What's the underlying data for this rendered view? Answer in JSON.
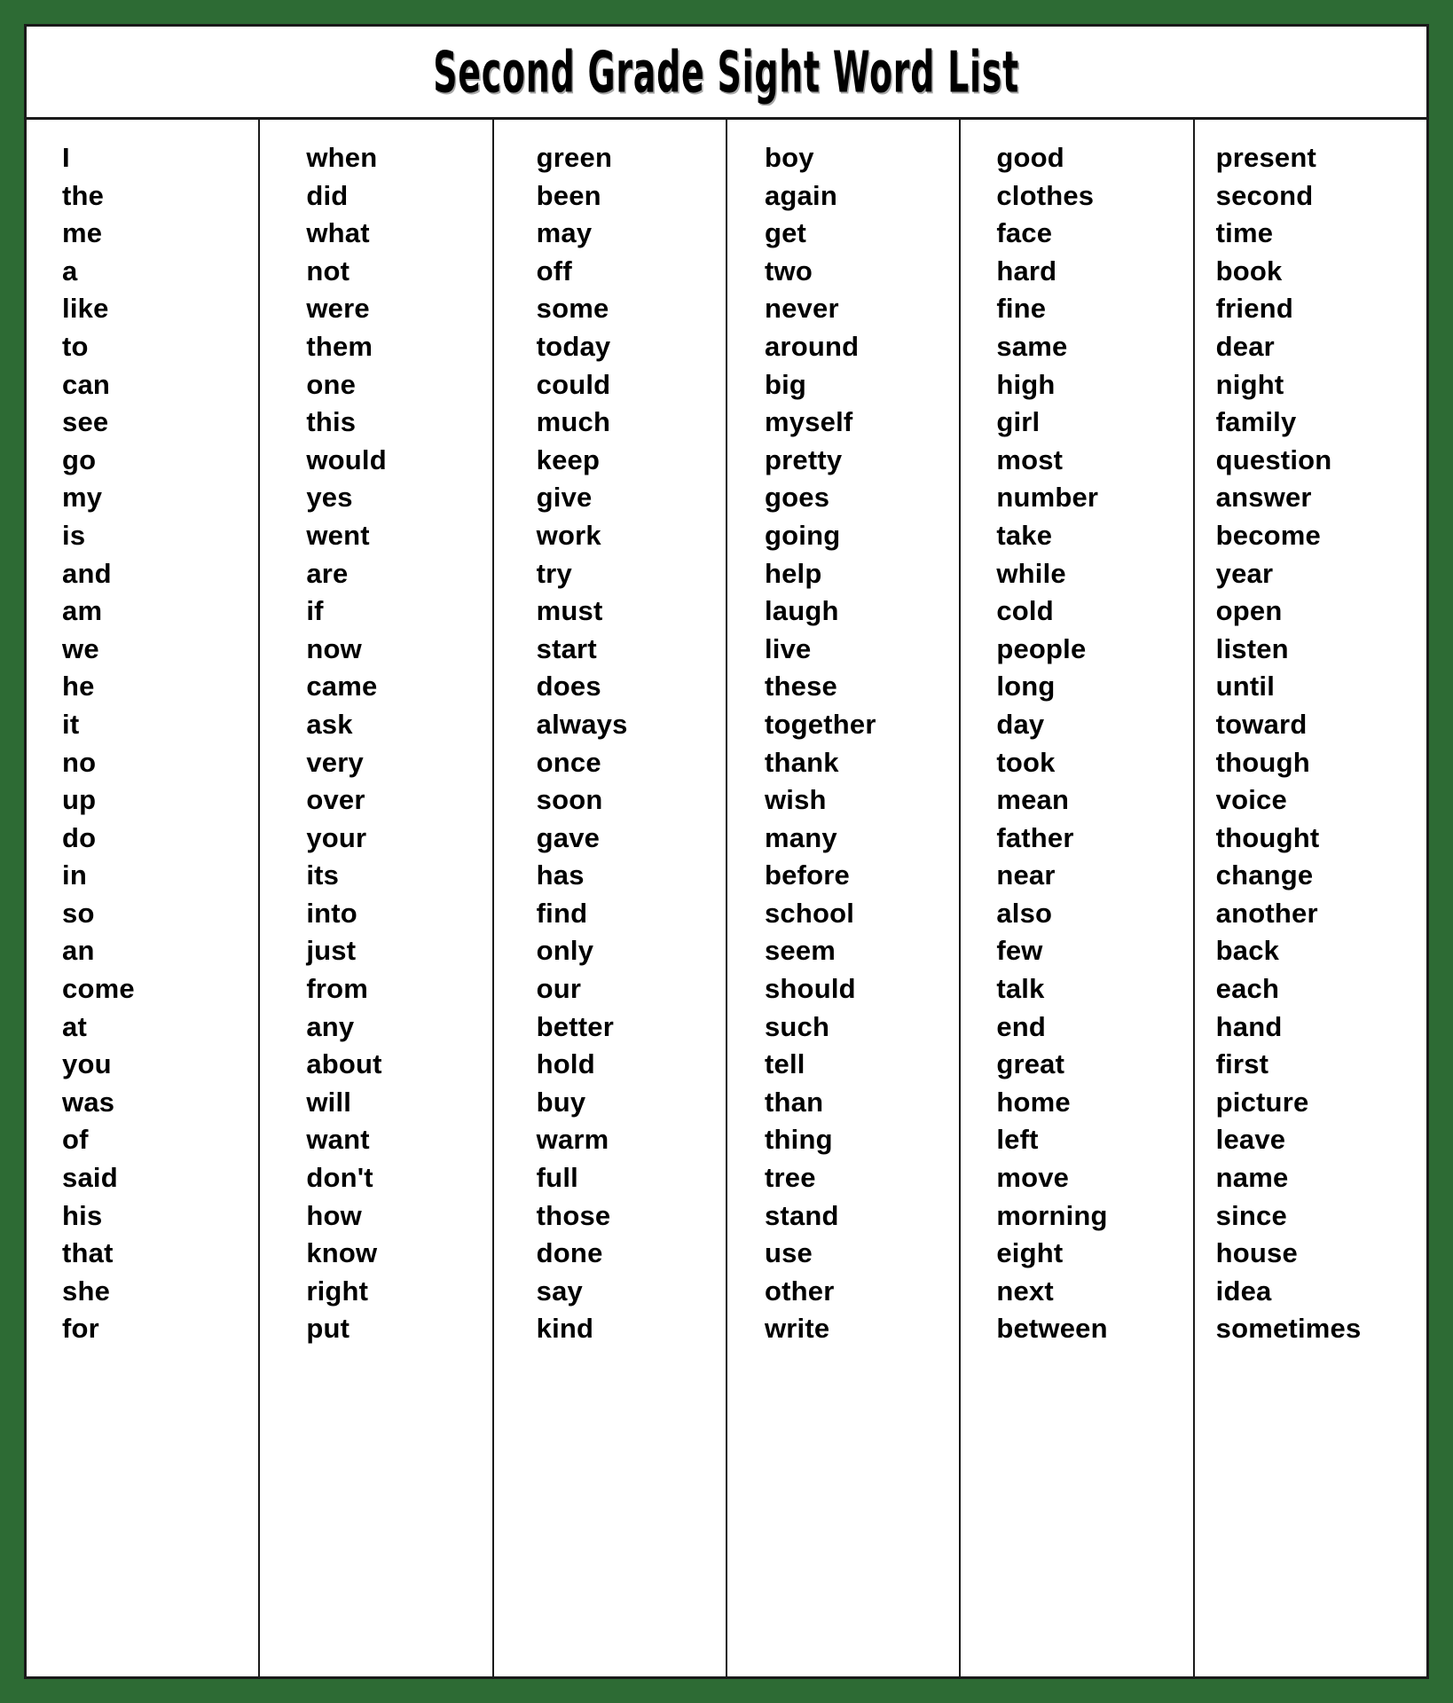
{
  "document": {
    "title": "Second Grade Sight Word List",
    "border_color": "#2d6b34",
    "rule_color": "#1a1a1a",
    "text_color": "#000000",
    "paper_color": "#ffffff"
  },
  "columns": [
    {
      "index": 1,
      "words": [
        "I",
        "the",
        "me",
        "a",
        "like",
        "to",
        "can",
        "see",
        "go",
        "my",
        "is",
        "and",
        "am",
        "we",
        "he",
        "it",
        "no",
        "up",
        "do",
        "in",
        "so",
        "an",
        "come",
        "at",
        "you",
        "was",
        "of",
        "said",
        "his",
        "that",
        "she",
        "for"
      ]
    },
    {
      "index": 2,
      "words": [
        "when",
        "did",
        "what",
        "not",
        "were",
        "them",
        "one",
        "this",
        "would",
        "yes",
        "went",
        "are",
        "if",
        "now",
        "came",
        "ask",
        "very",
        "over",
        "your",
        "its",
        "into",
        "just",
        "from",
        "any",
        "about",
        "will",
        "want",
        "don't",
        "how",
        "know",
        "right",
        "put"
      ]
    },
    {
      "index": 3,
      "words": [
        "green",
        "been",
        "may",
        "off",
        "some",
        "today",
        "could",
        "much",
        "keep",
        "give",
        "work",
        "try",
        "must",
        "start",
        "does",
        "always",
        "once",
        "soon",
        "gave",
        "has",
        "find",
        "only",
        "our",
        "better",
        "hold",
        "buy",
        "warm",
        "full",
        "those",
        "done",
        "say",
        "kind"
      ]
    },
    {
      "index": 4,
      "words": [
        "boy",
        "again",
        "get",
        "two",
        "never",
        "around",
        "big",
        "myself",
        "pretty",
        "goes",
        "going",
        "help",
        "laugh",
        "live",
        "these",
        "together",
        "thank",
        "wish",
        "many",
        "before",
        "school",
        "seem",
        "should",
        "such",
        "tell",
        "than",
        "thing",
        "tree",
        "stand",
        "use",
        "other",
        "write"
      ]
    },
    {
      "index": 5,
      "words": [
        "good",
        "clothes",
        "face",
        "hard",
        "fine",
        "same",
        "high",
        "girl",
        "most",
        "number",
        "take",
        "while",
        "cold",
        "people",
        "long",
        "day",
        "took",
        "mean",
        "father",
        "near",
        "also",
        "few",
        "talk",
        "end",
        "great",
        "home",
        "left",
        "move",
        "morning",
        "eight",
        "next",
        "between"
      ]
    },
    {
      "index": 6,
      "words": [
        "present",
        "second",
        "time",
        "book",
        "friend",
        "dear",
        "night",
        "family",
        "question",
        "answer",
        "become",
        "year",
        "open",
        "listen",
        "until",
        "toward",
        "though",
        "voice",
        "thought",
        "change",
        "another",
        "back",
        "each",
        "hand",
        "first",
        "picture",
        "leave",
        "name",
        "since",
        "house",
        "idea",
        "sometimes"
      ]
    }
  ]
}
